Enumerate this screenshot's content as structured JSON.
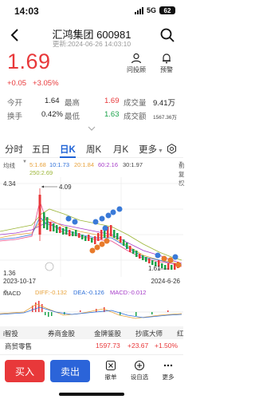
{
  "status_bar": {
    "time": "14:03",
    "network": "5G",
    "battery": "62"
  },
  "nav": {
    "title": "汇鸿集团 600981",
    "updated": "更新:2024-06-26 14:03:10"
  },
  "quote": {
    "price": "1.69",
    "change": "+0.05",
    "change_pct": "+3.05%",
    "actions": [
      "问投顾",
      "预警"
    ]
  },
  "stats": {
    "open_label": "今开",
    "open_value": "1.64",
    "high_label": "最高",
    "high_value": "1.69",
    "volume_label": "成交量",
    "volume_value": "9.41万",
    "turnover_label": "换手",
    "turnover_value": "0.42%",
    "low_label": "最低",
    "low_value": "1.63",
    "amount_label": "成交额",
    "amount_value": "1567.36万"
  },
  "tabs": [
    "分时",
    "五日",
    "日K",
    "周K",
    "月K",
    "更多"
  ],
  "active_tab": "日K",
  "ma": {
    "label": "均线",
    "ma5": "5:1.68",
    "ma10": "10:1.73",
    "ma20": "20:1.84",
    "ma60": "60:2.16",
    "ma30": "30:1.97",
    "ma250": "250:2.69",
    "adjust": "前复权"
  },
  "chart": {
    "y_max_label": "4.34",
    "y_min_label": "1.36",
    "high_mark": "4.09",
    "low_mark": "1.61",
    "start_date": "2023-10-17",
    "end_date": "2024-6-26"
  },
  "macd": {
    "label": "MACD",
    "dif": "DIFF:-0.132",
    "dea": "DEA:-0.126",
    "macd": "MACD:-0.012"
  },
  "news_tabs": [
    "i智投",
    "券商金股",
    "金牌鉴股",
    "抄底大师",
    "红"
  ],
  "sector": {
    "name": "商贸零售",
    "value": "1597.73",
    "change": "+23.67",
    "pct": "+1.50%"
  },
  "bottom": {
    "buy": "买入",
    "sell": "卖出",
    "actions": [
      "撤单",
      "设自选",
      "更多"
    ]
  },
  "colors": {
    "up": "#e8383a",
    "down": "#1aa34a",
    "accent": "#1f63d6"
  }
}
